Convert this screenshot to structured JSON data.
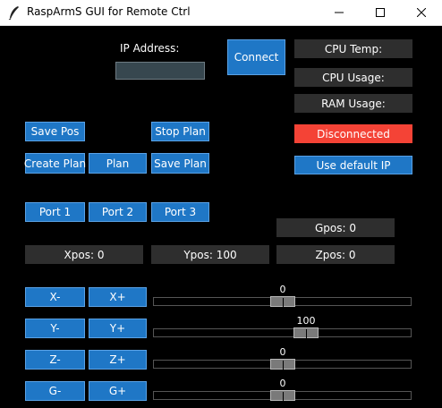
{
  "window": {
    "title": "RaspArmS GUI for Remote Ctrl"
  },
  "ip": {
    "label": "IP Address:",
    "value": ""
  },
  "buttons": {
    "connect": "Connect",
    "save_pos": "Save Pos",
    "stop_plan": "Stop Plan",
    "create_plan": "Create Plan",
    "plan": "Plan",
    "save_plan": "Save Plan",
    "port1": "Port 1",
    "port2": "Port 2",
    "port3": "Port 3",
    "use_default_ip": "Use default IP",
    "x_minus": "X-",
    "x_plus": "X+",
    "y_minus": "Y-",
    "y_plus": "Y+",
    "z_minus": "Z-",
    "z_plus": "Z+",
    "g_minus": "G-",
    "g_plus": "G+"
  },
  "status": {
    "cpu_temp": "CPU Temp:",
    "cpu_usage": "CPU Usage:",
    "ram_usage": "RAM Usage:",
    "connection": "Disconnected",
    "connection_color": "#f44336"
  },
  "positions": {
    "gpos": "Gpos: 0",
    "xpos": "Xpos: 0",
    "ypos": "Ypos: 100",
    "zpos": "Zpos: 0"
  },
  "sliders": [
    {
      "value": 0,
      "value_label": "0"
    },
    {
      "value": 100,
      "value_label": "100"
    },
    {
      "value": 0,
      "value_label": "0"
    },
    {
      "value": 0,
      "value_label": "0"
    }
  ],
  "slider_range": {
    "min": -500,
    "max": 500
  },
  "colors": {
    "button": "#1f77c6",
    "panel": "#2e2e2e",
    "background": "#000000"
  }
}
